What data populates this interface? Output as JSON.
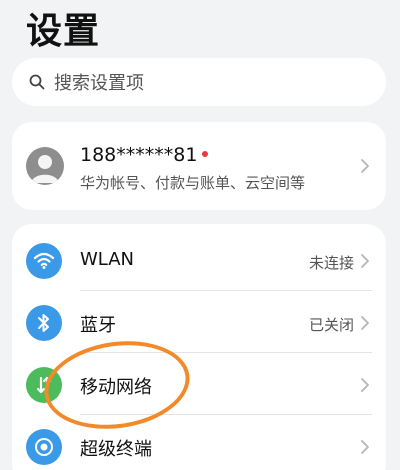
{
  "header": {
    "title": "设置"
  },
  "search": {
    "placeholder": "搜索设置项",
    "icon": "search-icon"
  },
  "account": {
    "name": "188******81",
    "subtitle": "华为帐号、付款与账单、云空间等",
    "notification_color": "#e8383d"
  },
  "settings": {
    "items": [
      {
        "label": "WLAN",
        "status": "未连接",
        "icon": "wifi-icon",
        "icon_color": "#3a9ae8"
      },
      {
        "label": "蓝牙",
        "status": "已关闭",
        "icon": "bluetooth-icon",
        "icon_color": "#3a9ae8"
      },
      {
        "label": "移动网络",
        "status": "",
        "icon": "mobile-data-icon",
        "icon_color": "#4cbb5c"
      },
      {
        "label": "超级终端",
        "status": "",
        "icon": "super-device-icon",
        "icon_color": "#3a9ae8"
      }
    ]
  },
  "annotation": {
    "color": "#f08a2a"
  }
}
